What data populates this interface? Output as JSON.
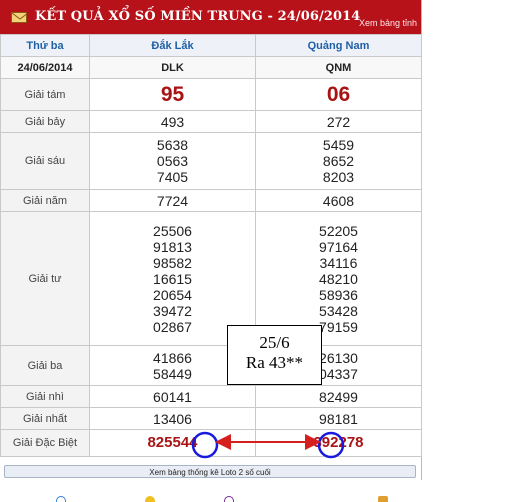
{
  "header": {
    "title": "KẾT QUẢ XỔ SỐ MIỀN TRUNG - 24/06/2014",
    "link": "Xem bảng tỉnh",
    "icon": "mail-icon"
  },
  "table": {
    "col_headers": [
      "Thứ ba",
      "Đắk Lắk",
      "Quảng Nam"
    ],
    "date": "24/06/2014",
    "codes": [
      "DLK",
      "QNM"
    ],
    "rows": {
      "g8": {
        "label": "Giải tám",
        "dlk": [
          "95"
        ],
        "qnm": [
          "06"
        ]
      },
      "g7": {
        "label": "Giải bảy",
        "dlk": [
          "493"
        ],
        "qnm": [
          "272"
        ]
      },
      "g6": {
        "label": "Giải sáu",
        "dlk": [
          "5638",
          "0563",
          "7405"
        ],
        "qnm": [
          "5459",
          "8652",
          "8203"
        ]
      },
      "g5": {
        "label": "Giải năm",
        "dlk": [
          "7724"
        ],
        "qnm": [
          "4608"
        ]
      },
      "g4": {
        "label": "Giải tư",
        "dlk": [
          "25506",
          "91813",
          "98582",
          "16615",
          "20654",
          "39472",
          "02867"
        ],
        "qnm": [
          "52205",
          "97164",
          "34116",
          "48210",
          "58936",
          "53428",
          "79159"
        ]
      },
      "g3": {
        "label": "Giải ba",
        "dlk": [
          "41866",
          "58449"
        ],
        "qnm": [
          "26130",
          "04337"
        ]
      },
      "g2": {
        "label": "Giải nhì",
        "dlk": [
          "60141"
        ],
        "qnm": [
          "82499"
        ]
      },
      "g1": {
        "label": "Giải nhất",
        "dlk": [
          "13406"
        ],
        "qnm": [
          "98181"
        ]
      },
      "gdb": {
        "label": "Giải Đặc Biệt",
        "dlk": [
          "825544"
        ],
        "qnm": [
          "392278"
        ]
      }
    }
  },
  "footer": {
    "button": "Xem bảng thống kê Loto 2 số cuối"
  },
  "annotation": {
    "line1": "25/6",
    "line2": "Ra 43**"
  },
  "colors": {
    "header": "#b7111a",
    "accent_text": "#a81314",
    "marker_blue": "#1a1adf",
    "arrow_red": "#d61e1e"
  }
}
